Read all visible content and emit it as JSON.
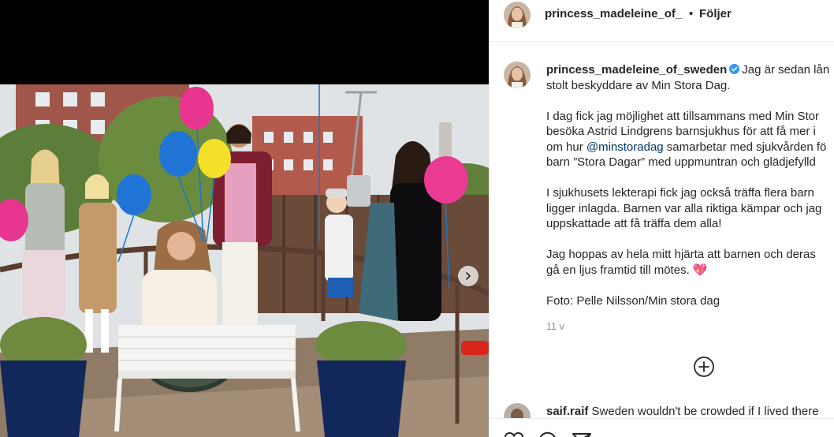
{
  "header": {
    "username": "princess_madeleine_of_",
    "separator": "•",
    "follow_label": "Följer"
  },
  "post": {
    "caption_username": "princess_madeleine_of_sweden",
    "caption_lines": [
      "Jag är sedan lån",
      "stolt beskyddare av Min Stora Dag.",
      "",
      "I dag fick jag möjlighet att tillsammans med Min Stor",
      "besöka Astrid Lindgrens barnsjukhus för att få mer i",
      "om hur ",
      "@minstoradag",
      " samarbetar med sjukvården fö",
      "barn ”Stora Dagar” med uppmuntran och glädjefylld",
      "",
      "I sjukhusets lekterapi fick jag också träffa flera barn",
      "ligger inlagda. Barnen var alla riktiga kämpar och jag",
      "uppskattade att få träffa dem alla!",
      "",
      "Jag hoppas av hela mitt hjärta att barnen och deras",
      "gå en ljus framtid till mötes. 💖",
      "",
      "Foto: Pelle Nilsson/Min stora dag"
    ],
    "timestamp": "11 v"
  },
  "comment": {
    "username": "saif.raif",
    "text": "Sweden wouldn't be crowded if I lived there"
  },
  "icons": {
    "verified": "verified-badge-icon",
    "next": "chevron-right-icon",
    "more": "plus-circle-icon"
  },
  "colors": {
    "verified_blue": "#3897f0",
    "mention": "#00376b",
    "muted": "#8e8e8e"
  }
}
